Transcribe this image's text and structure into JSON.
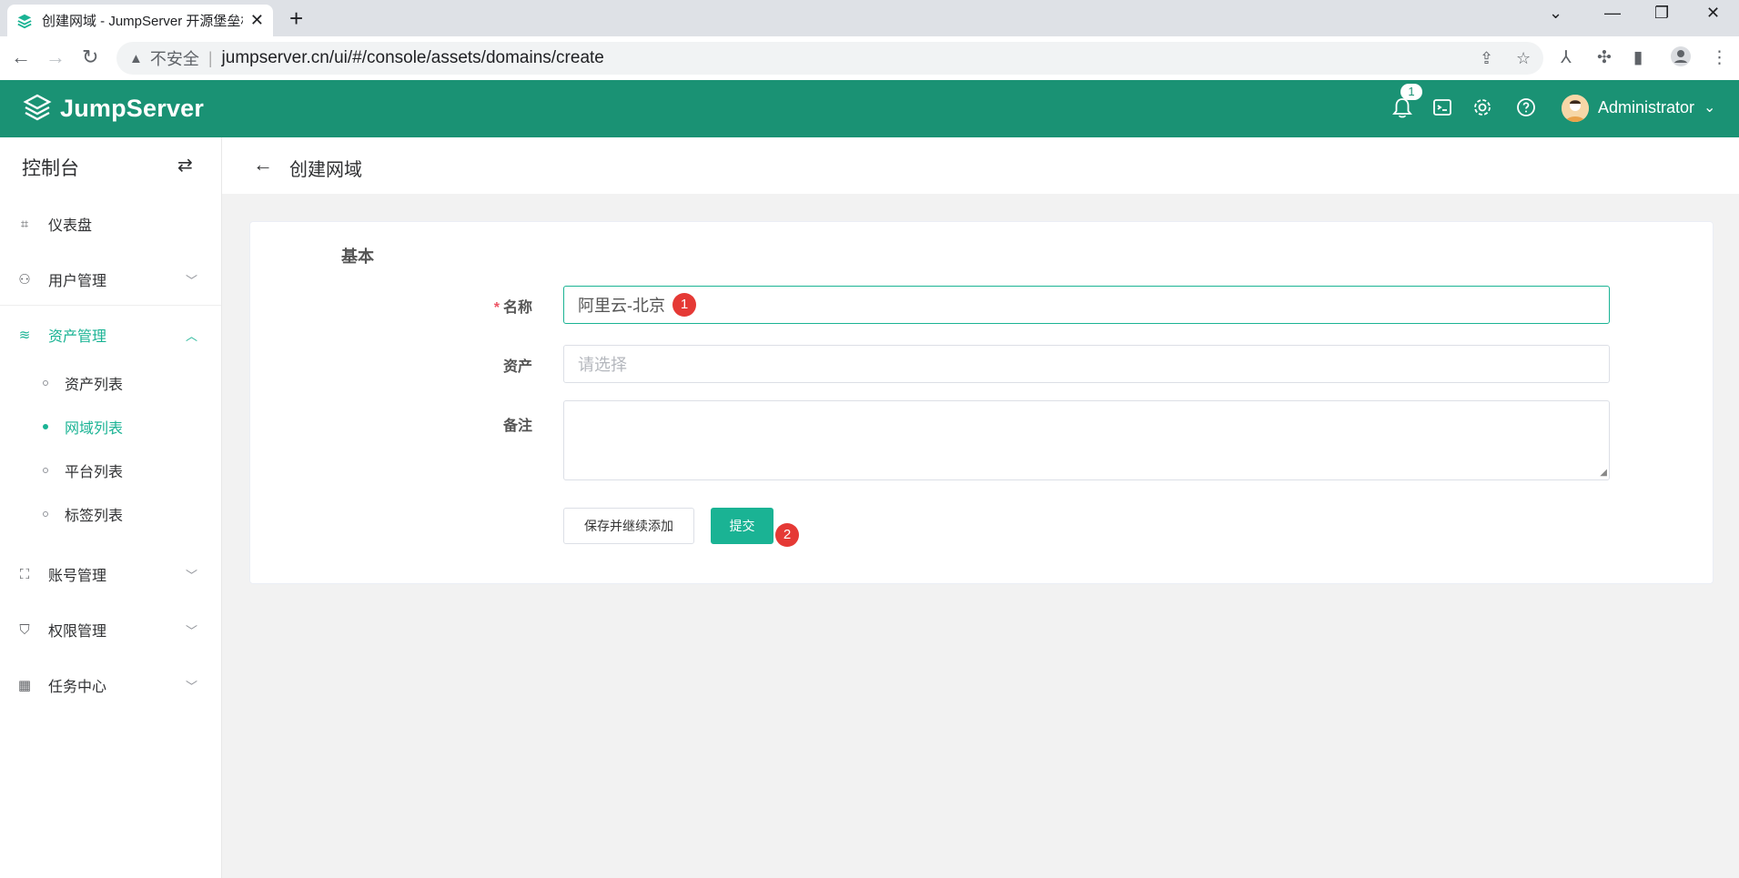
{
  "browser": {
    "tab_title": "创建网域 - JumpServer 开源堡垒机",
    "tab_close": "✕",
    "new_tab": "+",
    "insecure_label": "不安全",
    "separator": "|",
    "url": "jumpserver.cn/ui/#/console/assets/domains/create",
    "icons": [
      "back-icon",
      "forward-icon",
      "reload-icon",
      "share-icon",
      "star-icon",
      "extension-icon",
      "puzzle-icon",
      "sidepanel-icon",
      "profile-icon",
      "menu-icon"
    ]
  },
  "header": {
    "logo_text": "JumpServer",
    "notification_count": "1",
    "user_name": "Administrator",
    "accent_color": "#1a9274"
  },
  "sidebar": {
    "title": "控制台",
    "items": [
      {
        "label": "仪表盘",
        "icon": "dashboard-icon"
      },
      {
        "label": "用户管理",
        "icon": "users-icon"
      },
      {
        "label": "资产管理",
        "icon": "layers-icon"
      },
      {
        "label": "账号管理",
        "icon": "account-icon"
      },
      {
        "label": "权限管理",
        "icon": "shield-icon"
      },
      {
        "label": "任务中心",
        "icon": "calendar-icon"
      }
    ],
    "asset_sub_items": [
      {
        "label": "资产列表"
      },
      {
        "label": "网域列表"
      },
      {
        "label": "平台列表"
      },
      {
        "label": "标签列表"
      }
    ]
  },
  "page": {
    "title": "创建网域"
  },
  "form": {
    "section_title": "基本",
    "name_label": "名称",
    "name_required_mark": "*",
    "name_value": "阿里云-北京",
    "asset_label": "资产",
    "asset_placeholder": "请选择",
    "comment_label": "备注",
    "save_continue_label": "保存并继续添加",
    "submit_label": "提交"
  },
  "annotations": {
    "marker_1": "1",
    "marker_2": "2"
  }
}
